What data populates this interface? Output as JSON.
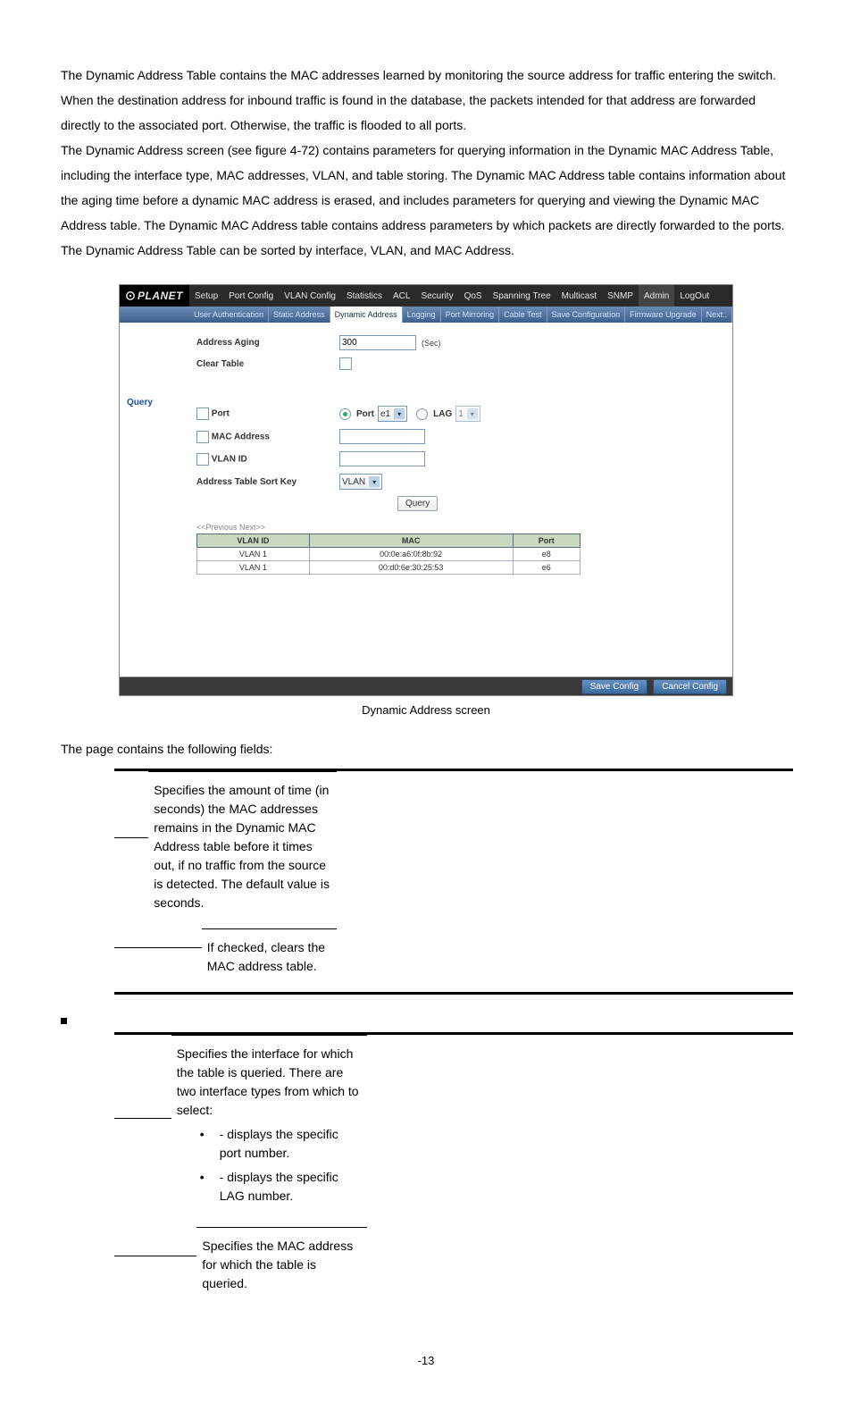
{
  "paragraph1": "The Dynamic Address Table contains the MAC addresses learned by monitoring the source address for traffic entering the switch. When the destination address for inbound traffic is found in the database, the packets intended for that address are forwarded directly to the associated port. Otherwise, the traffic is flooded to all ports.",
  "paragraph2": "The Dynamic Address screen (see figure 4-72) contains parameters for querying information in the Dynamic MAC Address Table, including the interface type, MAC addresses, VLAN, and table storing. The Dynamic MAC Address table contains information about the aging time before a dynamic MAC address is erased, and includes parameters for querying and viewing the Dynamic MAC Address table. The Dynamic MAC Address table contains address parameters by which packets are directly forwarded to the ports. The Dynamic Address Table can be sorted by interface, VLAN, and MAC Address.",
  "figure": {
    "logo": "PLANET",
    "topnav": [
      "Setup",
      "Port Config",
      "VLAN Config",
      "Statistics",
      "ACL",
      "Security",
      "QoS",
      "Spanning Tree",
      "Multicast",
      "SNMP",
      "Admin",
      "LogOut"
    ],
    "topnav_active": "Admin",
    "subnav": [
      "User Authentication",
      "Static Address",
      "Dynamic Address",
      "Logging",
      "Port Mirroring",
      "Cable Test",
      "Save Configuration",
      "Firmware Upgrade",
      "Next.."
    ],
    "subnav_active": "Dynamic Address",
    "side_section": "Query",
    "labels": {
      "address_aging": "Address Aging",
      "clear_table": "Clear Table",
      "port": "Port",
      "mac_address": "MAC Address",
      "vlan_id": "VLAN ID",
      "sort_key": "Address Table Sort Key"
    },
    "values": {
      "address_aging": "300",
      "sec": "(Sec)",
      "port_radio_label": "Port",
      "port_select": "e1",
      "lag_radio_label": "LAG",
      "lag_select": "1",
      "sort_select": "VLAN",
      "query_btn": "Query",
      "prevnext": "<<Previous  Next>>"
    },
    "table": {
      "headers": [
        "VLAN ID",
        "MAC",
        "Port"
      ],
      "rows": [
        [
          "VLAN 1",
          "00:0e:a6:0f:8b:92",
          "e8"
        ],
        [
          "VLAN 1",
          "00:d0:6e:30:25:53",
          "e6"
        ]
      ]
    },
    "footer_buttons": [
      "Save Config",
      "Cancel Config"
    ]
  },
  "caption": "Dynamic Address screen",
  "fields_intro": "The page contains the following fields:",
  "fields_table1": {
    "rows": [
      {
        "desc": "Specifies the amount of time (in seconds) the MAC addresses remains in the Dynamic MAC Address table before it times out, if no traffic from the source is detected. The default value is        seconds."
      },
      {
        "desc": "If checked, clears the MAC address table."
      }
    ]
  },
  "fields_table2": {
    "rows": [
      {
        "desc": "Specifies the interface for which the table is queried. There are two interface types from which to select:",
        "sub": [
          " - displays the specific port number.",
          " - displays the specific LAG number."
        ]
      },
      {
        "desc": "Specifies the MAC address for which the table is queried."
      }
    ]
  },
  "page_num": "-13"
}
